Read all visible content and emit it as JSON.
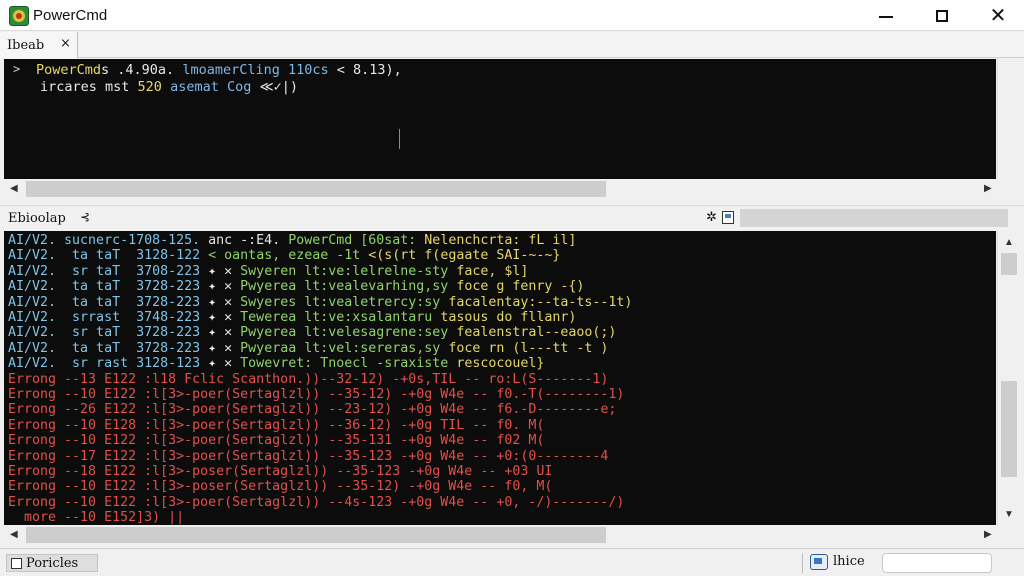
{
  "window": {
    "title": "PowerCmd",
    "minimize": "—",
    "maximize": "☐",
    "close": "✕"
  },
  "tabs": [
    {
      "label": "Ibeab",
      "close": "×"
    }
  ],
  "top_console": {
    "prompt": ">",
    "line1": {
      "a": "PowerCmd",
      "b": "s .4.90a.",
      "c": " lmoamerCling 110cs",
      "d": " < 8.13),",
      "e": ""
    },
    "line2": {
      "a": "ircares mst ",
      "b": "520",
      "c": " asemat Cog",
      "d": " ≪✓|)"
    }
  },
  "middle_bar": {
    "label": "Ebioolap",
    "pin": "⊰",
    "gear": "✲"
  },
  "log_lines": [
    {
      "a": "AI/V2. sucnerc-1708-125.",
      "b": " anc -:E4.",
      "c": " PowerCmd [60sat:",
      "d": " Nelenchcrta: fL il]"
    },
    {
      "a": "AI/V2.  ta taT  3128-122",
      "b": " ",
      "c": "< oantas, ezeae -1t ",
      "d": "<(s(rt f(egaate SAI-~-~}"
    },
    {
      "a": "AI/V2.  sr taT  3708-223",
      "b": " ✦ ✕ ",
      "c": "Swyeren lt:ve:lelrelne-sty ",
      "d": "face, $l]"
    },
    {
      "a": "AI/V2.  ta taT  3728-223",
      "b": " ✦ ✕ ",
      "c": "Pwyerea lt:vealevarhing,sy ",
      "d": "foce g fenry -{)"
    },
    {
      "a": "AI/V2.  ta taT  3728-223",
      "b": " ✦ ✕ ",
      "c": "Swyeres lt:vealetrercy:sy ",
      "d": "facalentay:--ta-ts--1t)"
    },
    {
      "a": "AI/V2.  srrast  3748-223",
      "b": " ✦ ✕ ",
      "c": "Tewerea lt:ve:xsalantaru ",
      "d": "tasous do fllanr)"
    },
    {
      "a": "AI/V2.  sr taT  3728-223",
      "b": " ✦ ✕ ",
      "c": "Pwyerea lt:velesagrene:sey ",
      "d": "fealenstral--eaoo(;)"
    },
    {
      "a": "AI/V2.  ta taT  3728-223",
      "b": " ✦ ✕ ",
      "c": "Pwyeraa lt:vel:sereras,sy ",
      "d": "foce rn (l---tt -t )"
    },
    {
      "a": "AI/V2.  sr rast 3128-123",
      "b": " ✦ ✕ ",
      "c": "Towevret: Tnoecl -sraxiste ",
      "d": "rescocouel}"
    },
    {
      "e": "Errong --13 E122 :l18 Fclic Scanthon.))--32-12) -+0s,TIL -- ro:L(S-------1)"
    },
    {
      "e": "Errong --10 E122 :l[3>-poer(Sertaglzl)) --35-12) -+0g W4e -- f0.-T(--------1)"
    },
    {
      "e": "Errong --26 E122 :l[3>-poer(Sertaglzl)) --23-12) -+0g W4e -- f6.-D--------e;"
    },
    {
      "e": "Errong --10 E128 :l[3>-poer(Sertaglzl)) --36-12) -+0g TIL -- f0. M("
    },
    {
      "e": "Errong --10 E122 :l[3>-poer(Sertaglzl)) --35-131 -+0g W4e -- f02 M("
    },
    {
      "e": "Errong --17 E122 :l[3>-poer(Sertaglzl)) --35-123 -+0g W4e -- +0:(0--------4"
    },
    {
      "e": "Errong --18 E122 :l[3>-poser(Sertaglzl)) --35-123 -+0g W4e -- +03 UI"
    },
    {
      "e": "Errong --10 E122 :l[3>-poser(Sertaglzl)) --35-12) -+0g W4e -- f0, M("
    },
    {
      "e": "Errong --10 E122 :l[3>-poer(Sertaglzl)) --4s-123 -+0g W4e -- +0, -/)-------/)"
    },
    {
      "e": "  more --10 E152]3) ||"
    }
  ],
  "status": {
    "left_label": "Poricles",
    "right_label": "lhice"
  }
}
